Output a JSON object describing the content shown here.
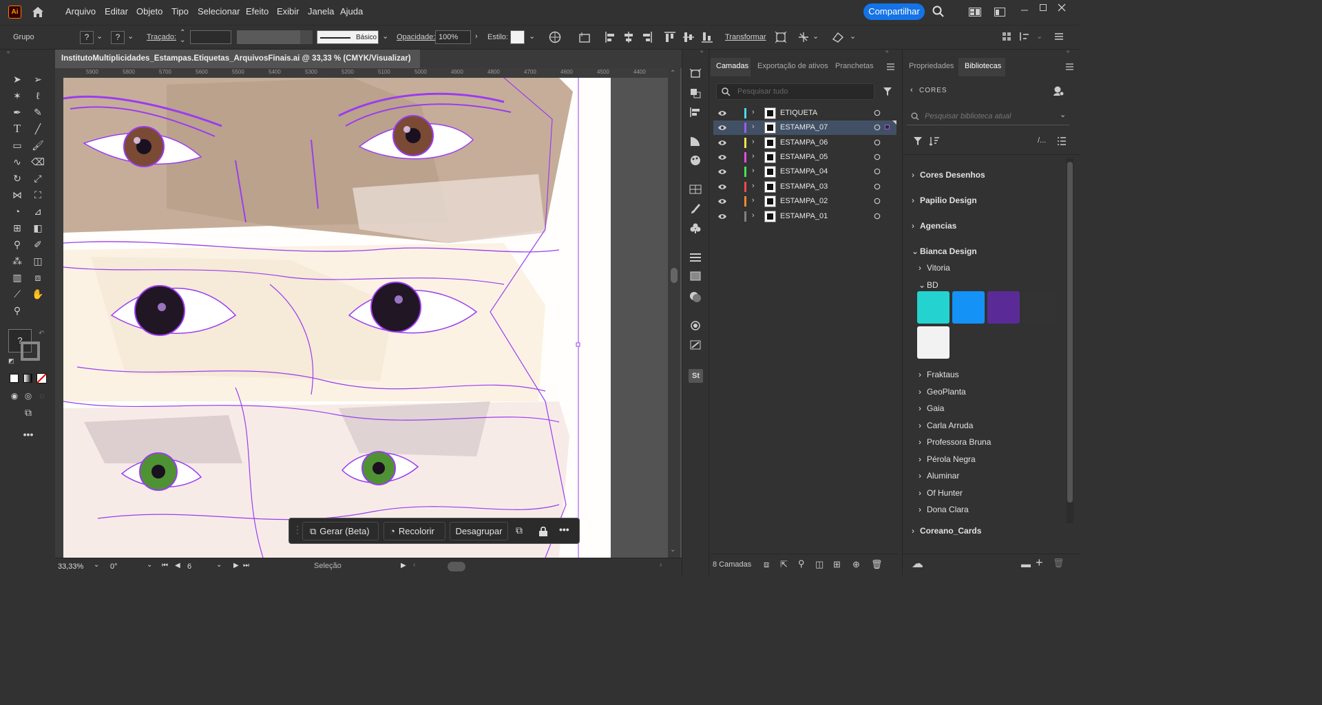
{
  "app": {
    "logo": "Ai",
    "share_label": "Compartilhar"
  },
  "menu": [
    "Arquivo",
    "Editar",
    "Objeto",
    "Tipo",
    "Selecionar",
    "Efeito",
    "Exibir",
    "Janela",
    "Ajuda"
  ],
  "control": {
    "group_label": "Grupo",
    "stroke_label": "Traçado:",
    "basic_label": "Básico",
    "opacity_label": "Opacidade:",
    "opacity_value": "100%",
    "style_label": "Estilo:",
    "transform_label": "Transformar",
    "unknown_fill": "?",
    "unknown_stroke": "?"
  },
  "document": {
    "tab_title": "InstitutoMultiplicidades_Estampas.Etiquetas_ArquivosFinais.ai @ 33,33 % (CMYK/Visualizar)",
    "close_glyph": "✕"
  },
  "ruler": {
    "ticks": [
      "5900",
      "5800",
      "5700",
      "5600",
      "5500",
      "5400",
      "5300",
      "5200",
      "5100",
      "5000",
      "4900",
      "4800",
      "4700",
      "4600",
      "4500",
      "4400"
    ]
  },
  "status": {
    "zoom": "33,33%",
    "rotation": "0°",
    "artboard": "6",
    "tool_name": "Seleção"
  },
  "context_bar": {
    "generate": "Gerar (Beta)",
    "recolor": "Recolorir",
    "ungroup": "Desagrupar"
  },
  "layers_panel": {
    "tabs": [
      "Camadas",
      "Exportação de ativos",
      "Pranchetas"
    ],
    "search_placeholder": "Pesquisar tudo",
    "count_label": "8 Camadas",
    "items": [
      {
        "name": "ETIQUETA",
        "color": "#4fd8f0"
      },
      {
        "name": "ESTAMPA_07",
        "color": "#9b5cf0"
      },
      {
        "name": "ESTAMPA_06",
        "color": "#f0e64a"
      },
      {
        "name": "ESTAMPA_05",
        "color": "#e64ae0"
      },
      {
        "name": "ESTAMPA_04",
        "color": "#4ae05a"
      },
      {
        "name": "ESTAMPA_03",
        "color": "#f04a4a"
      },
      {
        "name": "ESTAMPA_02",
        "color": "#f08a30"
      },
      {
        "name": "ESTAMPA_01",
        "color": "#808080"
      }
    ]
  },
  "libraries_panel": {
    "tabs": [
      "Propriedades",
      "Bibliotecas"
    ],
    "section": "CORES",
    "search_placeholder": "Pesquisar biblioteca atual",
    "groups_top": [
      "Cores Desenhos",
      "Papilio Design",
      "Agencias",
      "Bianca Design"
    ],
    "bianca_children": [
      "Vitoria",
      "BD"
    ],
    "swatches": [
      "#24d3d0",
      "#1492f6",
      "#5a2b96",
      "#333333",
      "#f2f2f2"
    ],
    "bianca_more": [
      "Fraktaus",
      "GeoPlanta",
      "Gaia",
      "Carla Arruda",
      "Professora Bruna",
      "Pérola Negra",
      "Aluminar",
      "Of Hunter",
      "Dona Clara"
    ],
    "groups_bottom": [
      "Coreano_Cards"
    ]
  },
  "colors": {
    "accent": "#1473e6",
    "selection_purple": "#9b3cf0",
    "layer_selected_bg": "#415064"
  }
}
